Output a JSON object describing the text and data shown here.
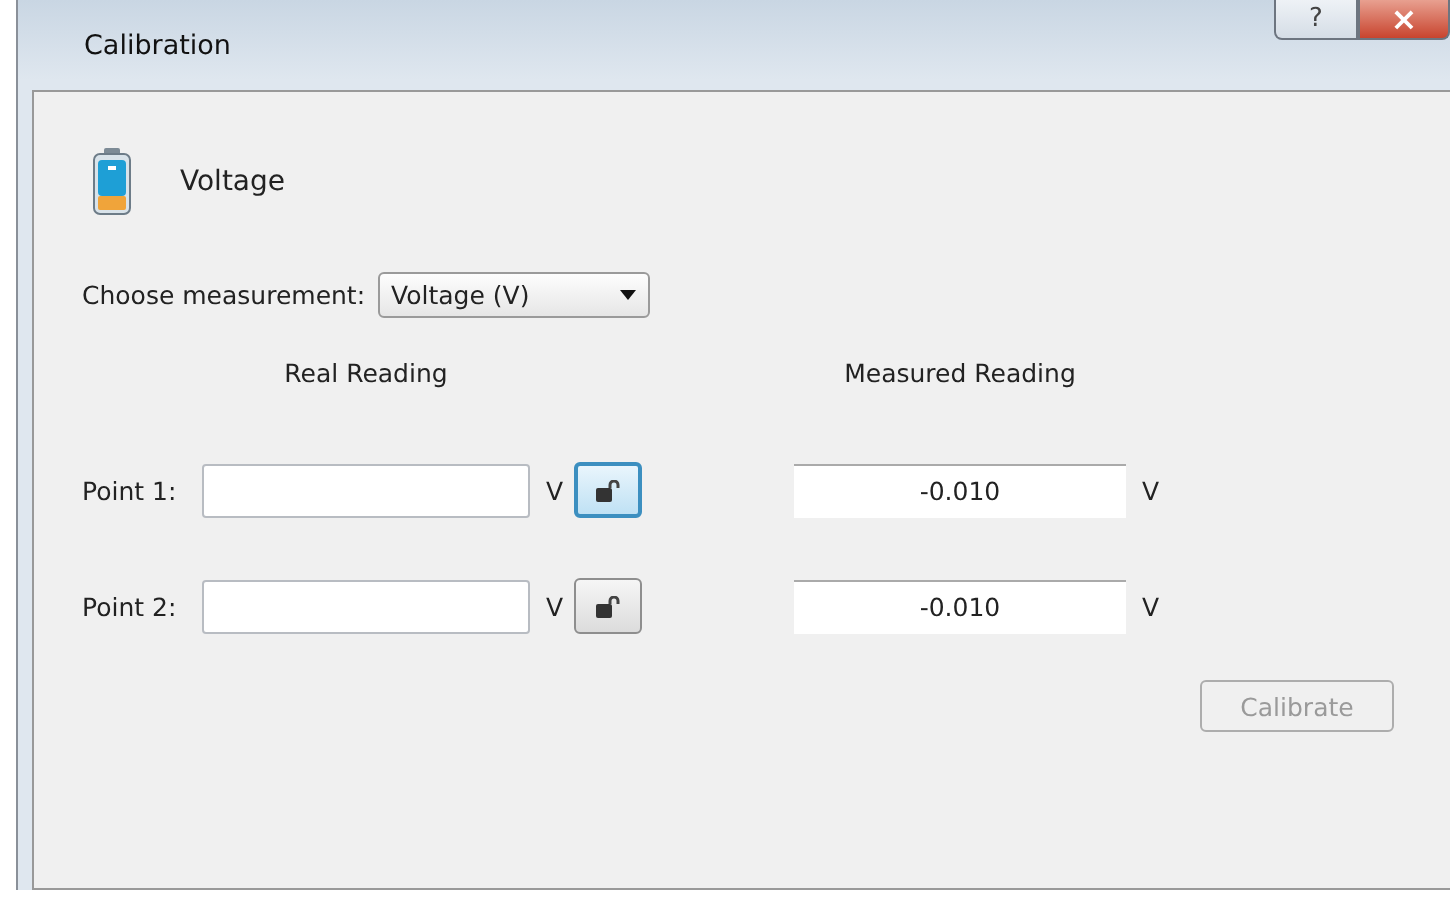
{
  "window": {
    "title": "Calibration",
    "help": "?",
    "close": "×"
  },
  "sensor": {
    "name": "Voltage"
  },
  "measurement": {
    "label": "Choose measurement:",
    "value": "Voltage (V)"
  },
  "columns": {
    "real": "Real Reading",
    "measured": "Measured Reading"
  },
  "points": [
    {
      "label": "Point 1:",
      "real_unit": "V",
      "lock_focused": true,
      "measured_value": "-0.010",
      "measured_unit": "V"
    },
    {
      "label": "Point 2:",
      "real_unit": "V",
      "lock_focused": false,
      "measured_value": "-0.010",
      "measured_unit": "V"
    }
  ],
  "calibrate_button": {
    "label": "Calibrate",
    "disabled": true
  }
}
